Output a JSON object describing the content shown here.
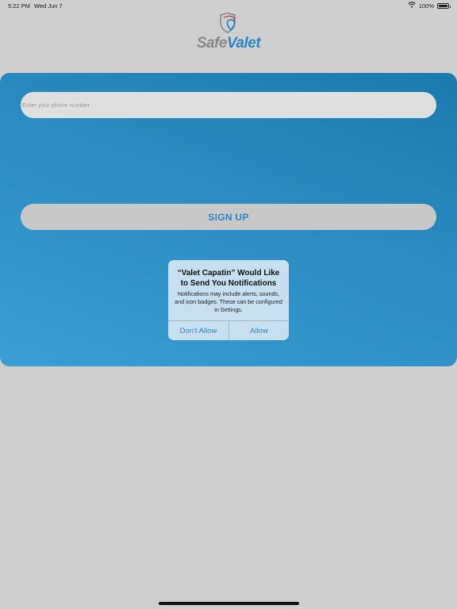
{
  "status_bar": {
    "time": "5:22 PM",
    "date": "Wed Jun 7",
    "battery": "100%",
    "battery_level": 1.0
  },
  "logo": {
    "text_safe": "Safe",
    "text_valet": "Valet",
    "icon": "shield-location-icon"
  },
  "form": {
    "phone_placeholder": "Enter your phone number",
    "phone_value": "",
    "signup_label": "SIGN UP"
  },
  "alert": {
    "title": "“Valet Capatin” Would Like to Send You Notifications",
    "message": "Notifications may include alerts, sounds, and icon badges. These can be configured in Settings.",
    "deny_label": "Don't Allow",
    "allow_label": "Allow"
  },
  "colors": {
    "accent": "#2e86c1",
    "background": "#cfcfcf",
    "card_top": "#1a7aad",
    "card_bottom": "#3b9fd3"
  }
}
